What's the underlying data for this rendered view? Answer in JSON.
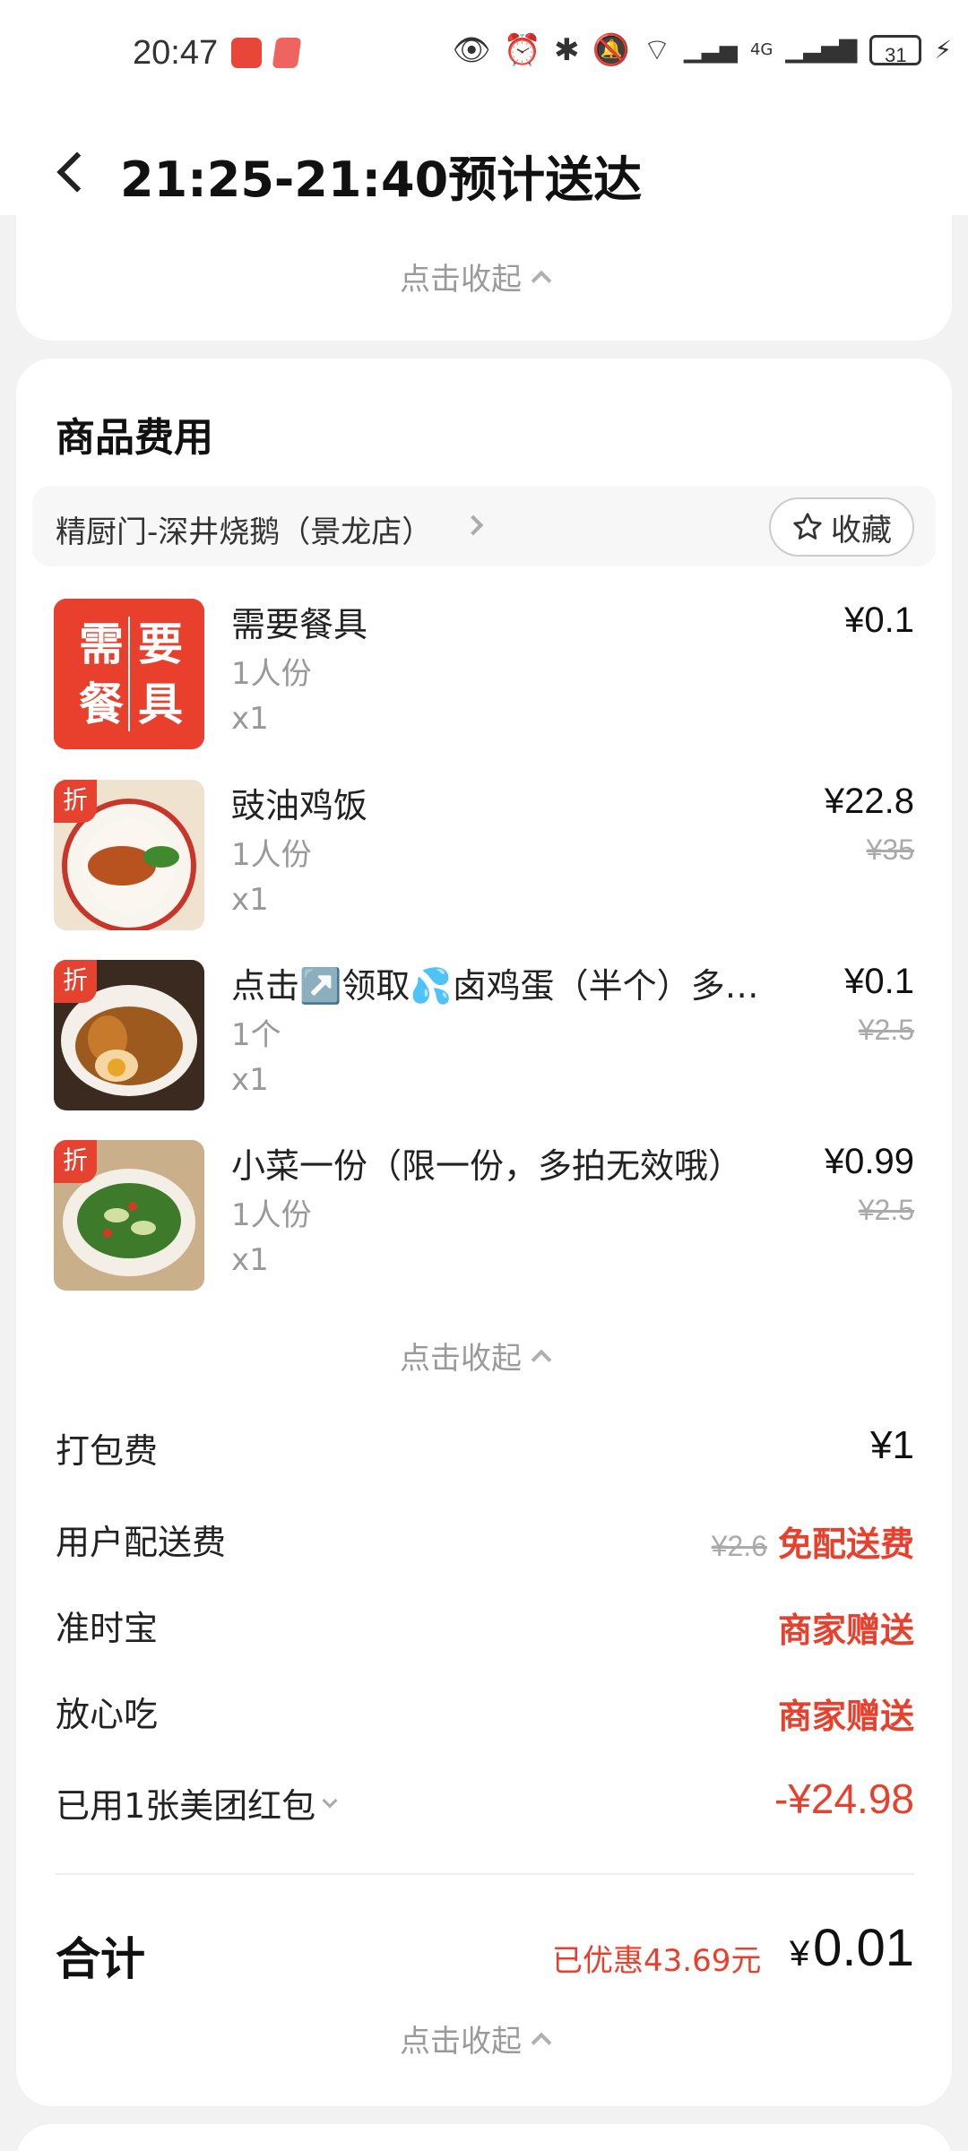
{
  "status_bar": {
    "time": "20:47",
    "battery": "31",
    "network": "4G"
  },
  "header": {
    "title": "21:25-21:40预计送达"
  },
  "collapse_label": "点击收起",
  "goods": {
    "section_title": "商品费用",
    "shop_name": "精厨门-深井烧鹅（景龙店）",
    "favorite_label": "收藏",
    "items": [
      {
        "name": "需要餐具",
        "spec": "1人份",
        "qty": "x1",
        "price": "¥0.1",
        "original_price": "",
        "discount_badge": "",
        "image_text": [
          "需",
          "要",
          "餐",
          "具"
        ]
      },
      {
        "name": "豉油鸡饭",
        "spec": "1人份",
        "qty": "x1",
        "price": "¥22.8",
        "original_price": "¥35",
        "discount_badge": "折"
      },
      {
        "name": "点击↗️领取💦卤鸡蛋（半个）多…",
        "spec": "1个",
        "qty": "x1",
        "price": "¥0.1",
        "original_price": "¥2.5",
        "discount_badge": "折"
      },
      {
        "name": "小菜一份（限一份，多拍无效哦）",
        "spec": "1人份",
        "qty": "x1",
        "price": "¥0.99",
        "original_price": "¥2.5",
        "discount_badge": "折"
      }
    ]
  },
  "fees": {
    "packing": {
      "label": "打包费",
      "value": "¥1"
    },
    "delivery": {
      "label": "用户配送费",
      "original": "¥2.6",
      "value": "免配送费"
    },
    "ontime": {
      "label": "准时宝",
      "value": "商家赠送"
    },
    "assured": {
      "label": "放心吃",
      "value": "商家赠送"
    },
    "redpacket": {
      "label": "已用1张美团红包",
      "value": "-¥24.98"
    }
  },
  "total": {
    "label": "合计",
    "saved": "已优惠43.69元",
    "currency": "¥",
    "amount": "0.01"
  },
  "colors": {
    "accent_red": "#e8402d",
    "bg": "#f2f2f2"
  }
}
